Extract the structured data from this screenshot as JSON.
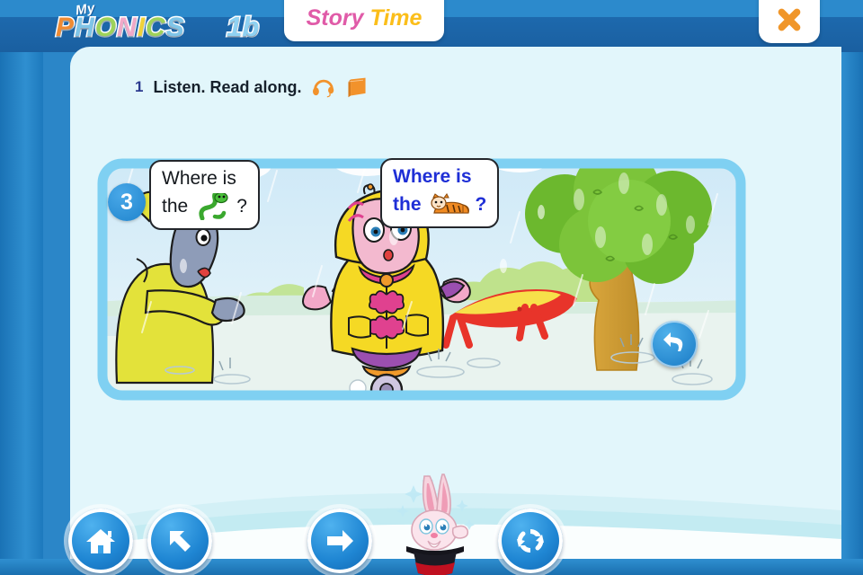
{
  "app": {
    "brand_prefix": "My",
    "brand_name": "PHONICS",
    "brand_level": "1b",
    "brand_letter_colors": [
      "#ef8b33",
      "#7fc5e8",
      "#9ed25a",
      "#f0a9c8",
      "#f0d23a",
      "#9ed25a",
      "#7fc5e8",
      "#ef8b33"
    ]
  },
  "header": {
    "title_part1": "Story",
    "title_part2": "Time",
    "title_part1_color": "#e05ba8",
    "title_part2_color": "#fbbe1a",
    "close_label": "Close",
    "close_icon": "close-x-icon",
    "close_color": "#f0962a"
  },
  "instruction": {
    "number": "1",
    "text": "Listen. Read along.",
    "headphones_icon": "headphones-icon",
    "book_icon": "book-icon",
    "icon_color": "#f2922b"
  },
  "scene": {
    "page_badge": "3",
    "badge_color": "#1f84cd",
    "replay_icon": "replay-arrow-icon",
    "weather": "rain",
    "bubbles": [
      {
        "speaker": "donkey",
        "text_before": "Where is",
        "text_line2": "the",
        "word_image": "snake-image",
        "text_after": "?",
        "text_color": "#14181d"
      },
      {
        "speaker": "girl",
        "text_before": "Where is",
        "text_line2": "the",
        "word_image": "tiger-image",
        "text_after": "?",
        "text_color": "#1f2fd6"
      }
    ]
  },
  "nav": {
    "home_label": "Home",
    "home_icon": "home-icon",
    "back_label": "Back",
    "back_icon": "arrow-up-left-icon",
    "next_label": "Next",
    "next_icon": "arrow-right-icon",
    "refresh_label": "Replay",
    "refresh_icon": "refresh-icon",
    "mascot": "magic-rabbit-mascot"
  }
}
